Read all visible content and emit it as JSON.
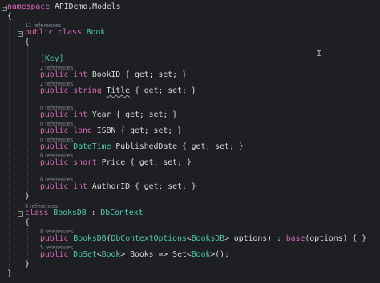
{
  "code": {
    "namespace_line": [
      "namespace",
      " APIDemo.Models"
    ],
    "open_brace": "{",
    "close_brace": "}",
    "book_lens": "11 references",
    "book_decl": [
      "public class ",
      "Book"
    ],
    "key_attr": "[Key]",
    "bookid_lens": "2 references",
    "bookid_line": [
      "public int ",
      "BookID { get; set; }"
    ],
    "title_lens": "2 references",
    "title_line": [
      "public string ",
      "Title",
      " { get; set; }"
    ],
    "year_lens": "0 references",
    "year_line": [
      "public int ",
      "Year { get; set; }"
    ],
    "isbn_lens": "0 references",
    "isbn_line": [
      "public long ",
      "ISBN { get; set; }"
    ],
    "pubdate_lens": "0 references",
    "pubdate_line": [
      "public ",
      "DateTime",
      " PublishedDate { get; set; }"
    ],
    "price_lens": "0 references",
    "price_line": [
      "public short ",
      "Price { get; set; }"
    ],
    "authorid_lens": "0 references",
    "authorid_line": [
      "public int ",
      "AuthorID { get; set; }"
    ],
    "booksdb_lens": "8 references",
    "booksdb_decl": [
      "class ",
      "BooksDB",
      " : ",
      "DbContext"
    ],
    "ctor_lens": "0 references",
    "ctor_line": [
      "public ",
      "BooksDB",
      "(",
      "DbContextOptions",
      "<",
      "BooksDB",
      "> options) : ",
      "base",
      "(options) { }"
    ],
    "dbset_lens": "5 references",
    "dbset_line": [
      "public ",
      "DbSet",
      "<",
      "Book",
      "> Books => Set<",
      "Book",
      ">();"
    ]
  },
  "cursor_glyph": "I",
  "fold_glyph": "−",
  "colors": {
    "background": "#1e1f22",
    "keyword": "#d66ab5",
    "type": "#4ec9b0",
    "text": "#d6d8dc",
    "codelens": "#868a94"
  }
}
